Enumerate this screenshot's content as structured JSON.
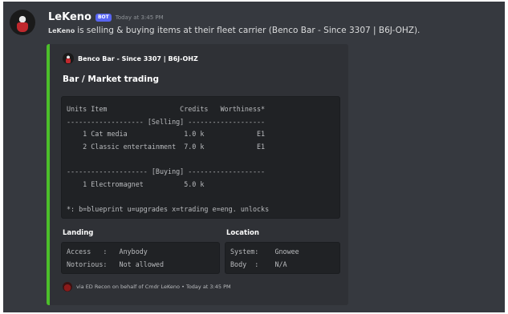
{
  "message": {
    "username": "LeKeno",
    "bot_badge": "BOT",
    "timestamp": "Today at 3:45 PM",
    "text_mention": "LeKeno",
    "text": "is selling & buying items at their fleet carrier (Benco Bar - Since 3307 | B6J-OHZ)."
  },
  "embed": {
    "color": "#4cbf2a",
    "author": "Benco Bar - Since 3307 | B6J-OHZ",
    "title": "Bar / Market trading",
    "code_lines": [
      "Units Item                  Credits   Worthiness*",
      "------------------- [Selling] -------------------",
      "    1 Cat media              1.0 k             E1",
      "    2 Classic entertainment  7.0 k             E1",
      "",
      "-------------------- [Buying] -------------------",
      "    1 Electromagnet          5.0 k",
      "",
      "*: b=blueprint u=upgrades x=trading e=eng. unlocks"
    ],
    "fields": [
      {
        "name": "Landing",
        "lines": [
          "Access   :   Anybody",
          "Notorious:   Not allowed"
        ]
      },
      {
        "name": "Location",
        "lines": [
          "System:    Gnowee",
          "Body  :    N/A"
        ]
      }
    ],
    "footer": "via ED Recon on behalf of Cmdr LeKeno • Today at 3:45 PM"
  }
}
